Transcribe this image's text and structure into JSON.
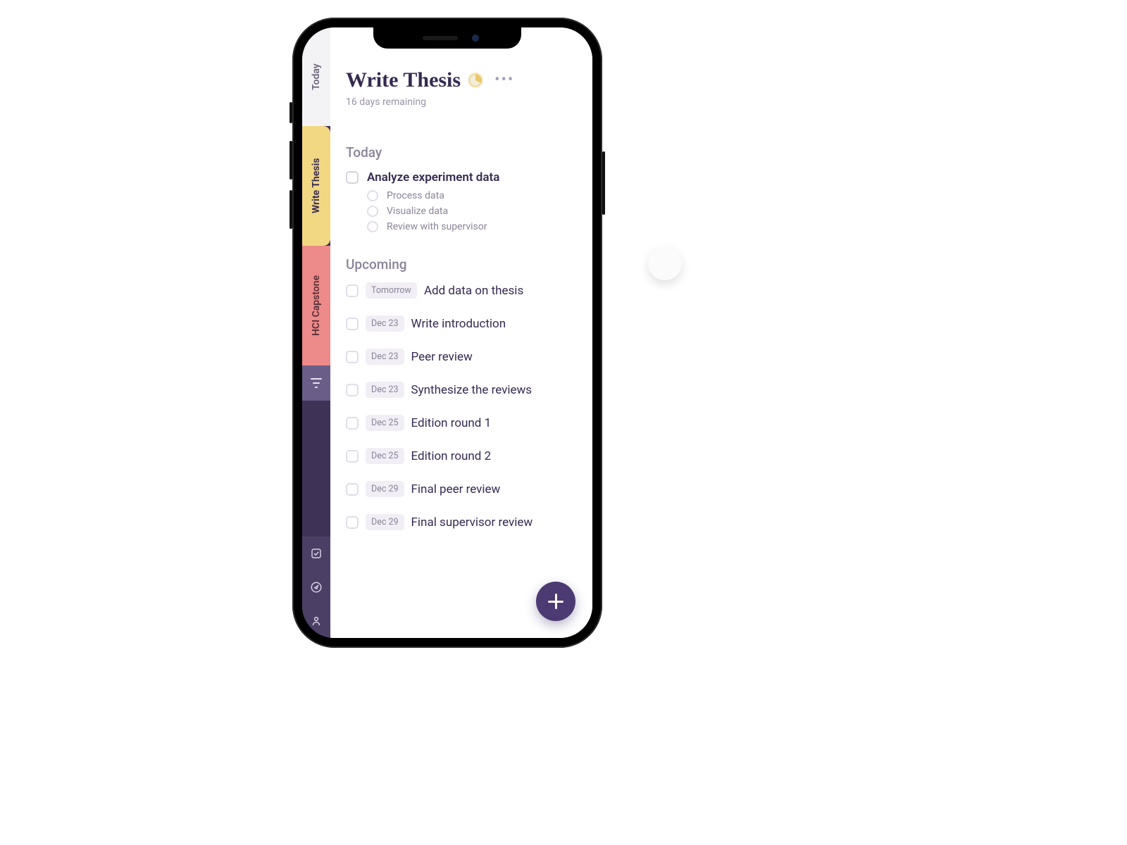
{
  "sidebar": {
    "tabs": [
      {
        "label": "Today"
      },
      {
        "label": "Write Thesis"
      },
      {
        "label": "HCI Capstone"
      }
    ],
    "icons": {
      "filter": "filter-icon",
      "checklist": "checklist-icon",
      "compass": "compass-icon",
      "profile": "profile-icon"
    }
  },
  "header": {
    "title": "Write Thesis",
    "subtitle": "16 days remaining",
    "progress_icon": "progress-pie-icon"
  },
  "today": {
    "label": "Today",
    "task": {
      "label": "Analyze experiment data",
      "subtasks": [
        "Process data",
        "Visualize data",
        "Review with supervisor"
      ]
    }
  },
  "upcoming": {
    "label": "Upcoming",
    "items": [
      {
        "date": "Tomorrow",
        "label": "Add data on thesis"
      },
      {
        "date": "Dec 23",
        "label": "Write introduction"
      },
      {
        "date": "Dec 23",
        "label": "Peer review"
      },
      {
        "date": "Dec 23",
        "label": "Synthesize the reviews"
      },
      {
        "date": "Dec 25",
        "label": "Edition round 1"
      },
      {
        "date": "Dec 25",
        "label": "Edition round 2"
      },
      {
        "date": "Dec 29",
        "label": "Final peer review"
      },
      {
        "date": "Dec 29",
        "label": "Final supervisor review"
      }
    ]
  },
  "fab": {
    "name": "add-task-button"
  },
  "colors": {
    "accent": "#4c3a72",
    "tab_today": "#f3f3f5",
    "tab_thesis": "#f3d884",
    "tab_hci": "#ed8a8a"
  }
}
